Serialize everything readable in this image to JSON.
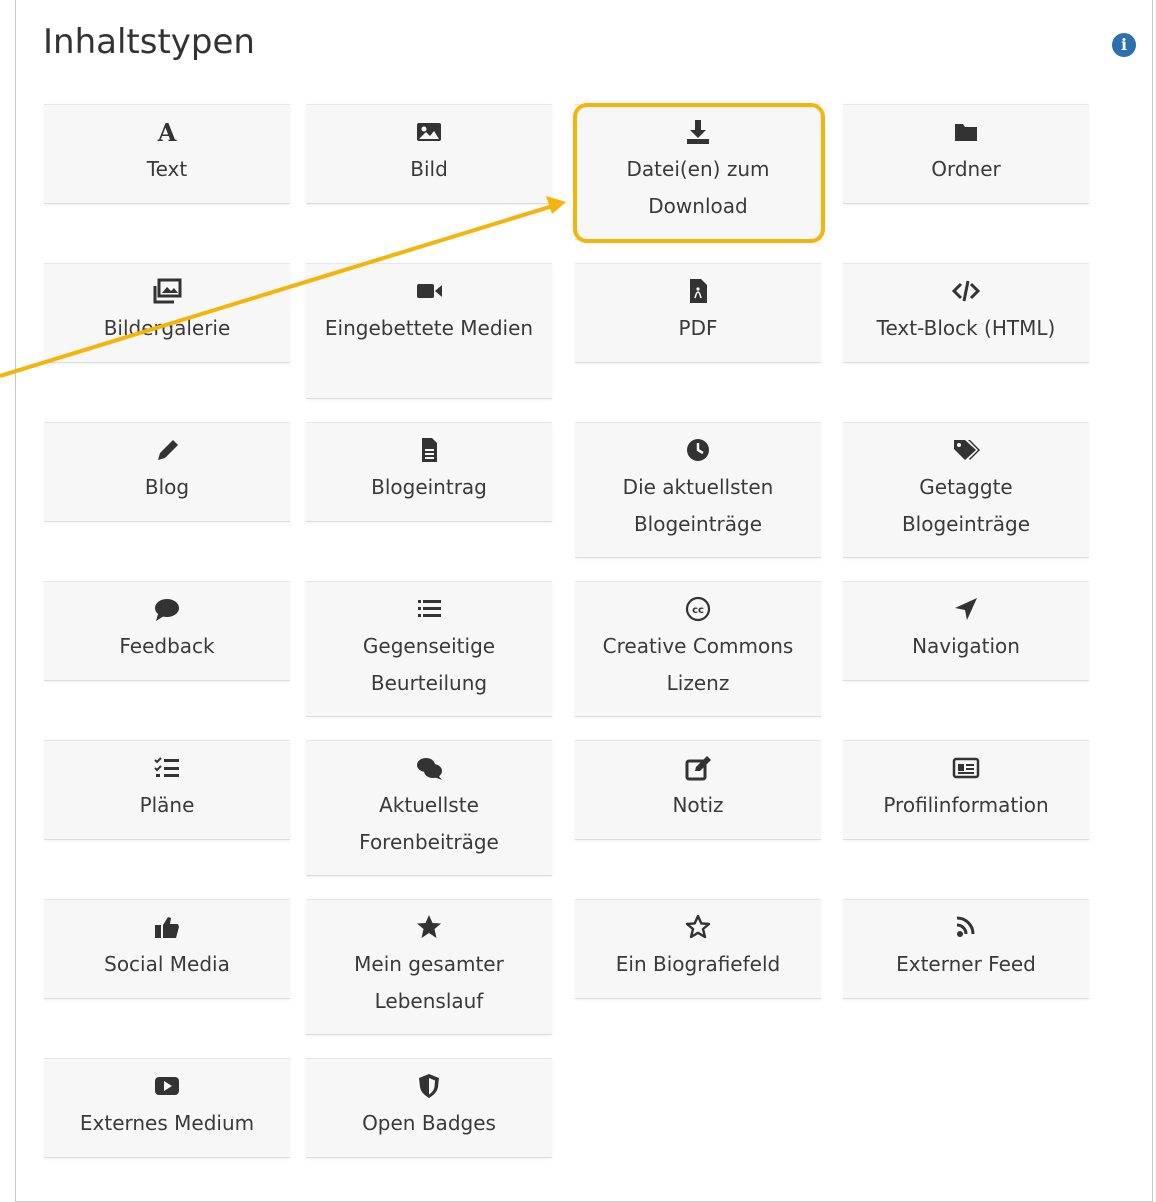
{
  "panel": {
    "title": "Inhaltstypen",
    "info_icon": "info-icon"
  },
  "tiles": [
    {
      "label": "Text",
      "icon": "text-icon"
    },
    {
      "label": "Bild",
      "icon": "image-icon"
    },
    {
      "label": "Datei(en) zum Download",
      "icon": "download-icon"
    },
    {
      "label": "Ordner",
      "icon": "folder-icon"
    },
    {
      "label": "Bildergalerie",
      "icon": "gallery-icon"
    },
    {
      "label": "Eingebettete Medien",
      "icon": "video-camera-icon"
    },
    {
      "label": "PDF",
      "icon": "pdf-icon"
    },
    {
      "label": "Text-Block (HTML)",
      "icon": "code-icon"
    },
    {
      "label": "Blog",
      "icon": "pencil-icon"
    },
    {
      "label": "Blogeintrag",
      "icon": "document-icon"
    },
    {
      "label": "Die aktuellsten Blogeinträge",
      "icon": "clock-icon"
    },
    {
      "label": "Getaggte Blogeinträge",
      "icon": "tags-icon"
    },
    {
      "label": "Feedback",
      "icon": "comment-icon"
    },
    {
      "label": "Gegenseitige Beurteilung",
      "icon": "list-icon"
    },
    {
      "label": "Creative Commons Lizenz",
      "icon": "creative-commons-icon"
    },
    {
      "label": "Navigation",
      "icon": "location-arrow-icon"
    },
    {
      "label": "Pläne",
      "icon": "tasks-icon"
    },
    {
      "label": "Aktuellste Forenbeiträge",
      "icon": "comments-icon"
    },
    {
      "label": "Notiz",
      "icon": "edit-note-icon"
    },
    {
      "label": "Profilinformation",
      "icon": "id-card-icon"
    },
    {
      "label": "Social Media",
      "icon": "thumbs-up-icon"
    },
    {
      "label": "Mein gesamter Lebenslauf",
      "icon": "star-icon"
    },
    {
      "label": "Ein Biografiefeld",
      "icon": "star-outline-icon"
    },
    {
      "label": "Externer Feed",
      "icon": "rss-icon"
    },
    {
      "label": "Externes Medium",
      "icon": "youtube-icon"
    },
    {
      "label": "Open Badges",
      "icon": "shield-icon"
    }
  ],
  "colors": {
    "highlight": "#f6b40b",
    "info": "#2e6fad",
    "icon": "#333333"
  }
}
